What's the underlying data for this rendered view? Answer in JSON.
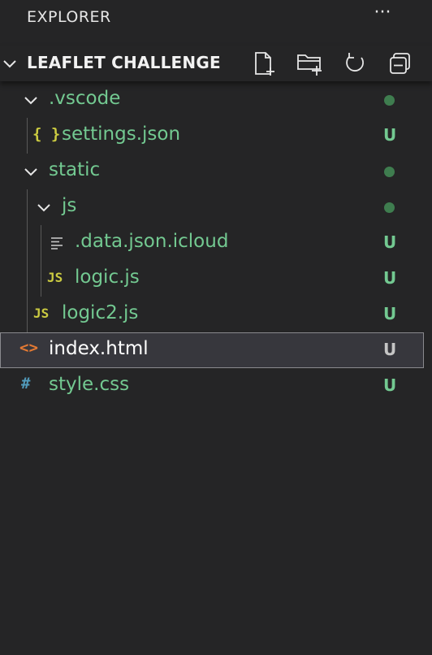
{
  "header": {
    "title": "EXPLORER",
    "more_label": "···"
  },
  "section": {
    "name": "LEAFLET CHALLENGE",
    "actions": [
      {
        "icon": "new-file-icon"
      },
      {
        "icon": "new-folder-icon"
      },
      {
        "icon": "refresh-icon"
      },
      {
        "icon": "collapse-all-icon"
      }
    ]
  },
  "tree": [
    {
      "label": ".vscode",
      "kind": "folder",
      "expanded": true,
      "depth": 1,
      "status": "dot"
    },
    {
      "label": "settings.json",
      "kind": "json",
      "icon_text": "{ }",
      "depth": 2,
      "status": "U"
    },
    {
      "label": "static",
      "kind": "folder",
      "expanded": true,
      "depth": 1,
      "status": "dot"
    },
    {
      "label": "js",
      "kind": "folder",
      "expanded": true,
      "depth": 2,
      "status": "dot"
    },
    {
      "label": ".data.json.icloud",
      "kind": "text",
      "depth": 3,
      "status": "U"
    },
    {
      "label": "logic.js",
      "kind": "js",
      "icon_text": "JS",
      "depth": 3,
      "status": "U"
    },
    {
      "label": "logic2.js",
      "kind": "js",
      "icon_text": "JS",
      "depth": 2,
      "status": "U"
    },
    {
      "label": "index.html",
      "kind": "html",
      "icon_text": "<>",
      "depth": 1,
      "status": "U",
      "selected": true
    },
    {
      "label": "style.css",
      "kind": "css",
      "icon_text": "#",
      "depth": 1,
      "status": "U"
    }
  ],
  "colors": {
    "background": "#252526",
    "untracked": "#73c991",
    "modified_dot": "#3f7d4f",
    "selected_bg": "#37373d",
    "json_icon": "#cbcb41",
    "js_icon": "#cbcb41",
    "html_icon": "#e37933",
    "css_icon": "#519aba"
  }
}
